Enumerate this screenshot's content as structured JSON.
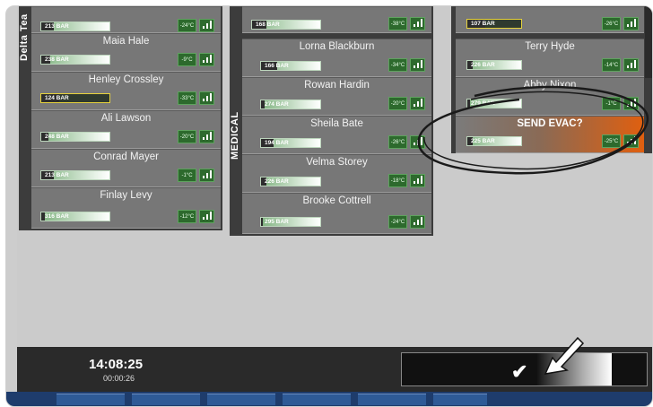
{
  "teams": {
    "left": {
      "label": "Delta Tea"
    },
    "middle": {
      "label": "MEDICAL"
    }
  },
  "left_column": {
    "top": {
      "bar": "213 BAR",
      "temp": "-24°C"
    },
    "rows": [
      {
        "name": "Maia Hale",
        "bar": "238 BAR",
        "temp": "-9°C"
      },
      {
        "name": "Henley Crossley",
        "bar": "124 BAR",
        "temp": "-33°C"
      },
      {
        "name": "Ali Lawson",
        "bar": "248 BAR",
        "temp": "-20°C"
      },
      {
        "name": "Conrad Mayer",
        "bar": "213 BAR",
        "temp": "-1°C"
      },
      {
        "name": "Finlay Levy",
        "bar": "316 BAR",
        "temp": "-12°C"
      }
    ]
  },
  "middle_column": {
    "top": {
      "bar": "168 BAR",
      "temp": "-38°C"
    },
    "rows": [
      {
        "name": "Lorna Blackburn",
        "bar": "166 BAR",
        "temp": "-34°C"
      },
      {
        "name": "Rowan Hardin",
        "bar": "274 BAR",
        "temp": "-20°C"
      },
      {
        "name": "Sheila Bate",
        "bar": "194 BAR",
        "temp": "-26°C"
      },
      {
        "name": "Velma Storey",
        "bar": "226 BAR",
        "temp": "-18°C"
      },
      {
        "name": "Brooke Cottrell",
        "bar": "295 BAR",
        "temp": "-24°C"
      }
    ]
  },
  "right_column": {
    "top": {
      "bar": "107 BAR",
      "temp": "-26°C"
    },
    "rows": [
      {
        "name": "Terry Hyde",
        "bar": "226 BAR",
        "temp": "-14°C"
      },
      {
        "name": "Abby Nixon",
        "bar": "279 BAR",
        "temp": "-1°C"
      },
      {
        "name": "SEND EVAC?",
        "bar": "225 BAR",
        "temp": "-25°C"
      }
    ]
  },
  "footer": {
    "clock": "14:08:25",
    "elapsed": "00:00:26"
  },
  "colors": {
    "evac_accent": "#e05f0f",
    "status_green": "#2d6a2d",
    "highlight_border": "#e6d23c"
  },
  "icons": {
    "signal": "signal-bars-icon",
    "confirm": "checkmark-icon",
    "pointer": "arrow-cursor-icon"
  }
}
